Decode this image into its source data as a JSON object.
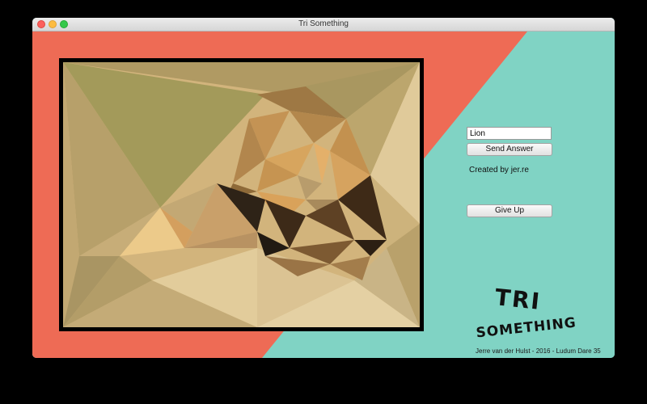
{
  "window": {
    "title": "Tri Something"
  },
  "game": {
    "answer_value": "Lion",
    "send_label": "Send Answer",
    "credit_text": "Created by jer.re",
    "give_up_label": "Give Up",
    "logo_line1": "TRI",
    "logo_line2": "SOMETHING",
    "footer_text": "Jerre van der Hulst - 2016 - Ludum Dare 35"
  },
  "colors": {
    "coral": "#ee6b55",
    "teal": "#80d3c4",
    "frame": "#000000"
  },
  "icons": [
    "close-icon",
    "minimize-icon",
    "maximize-icon"
  ]
}
